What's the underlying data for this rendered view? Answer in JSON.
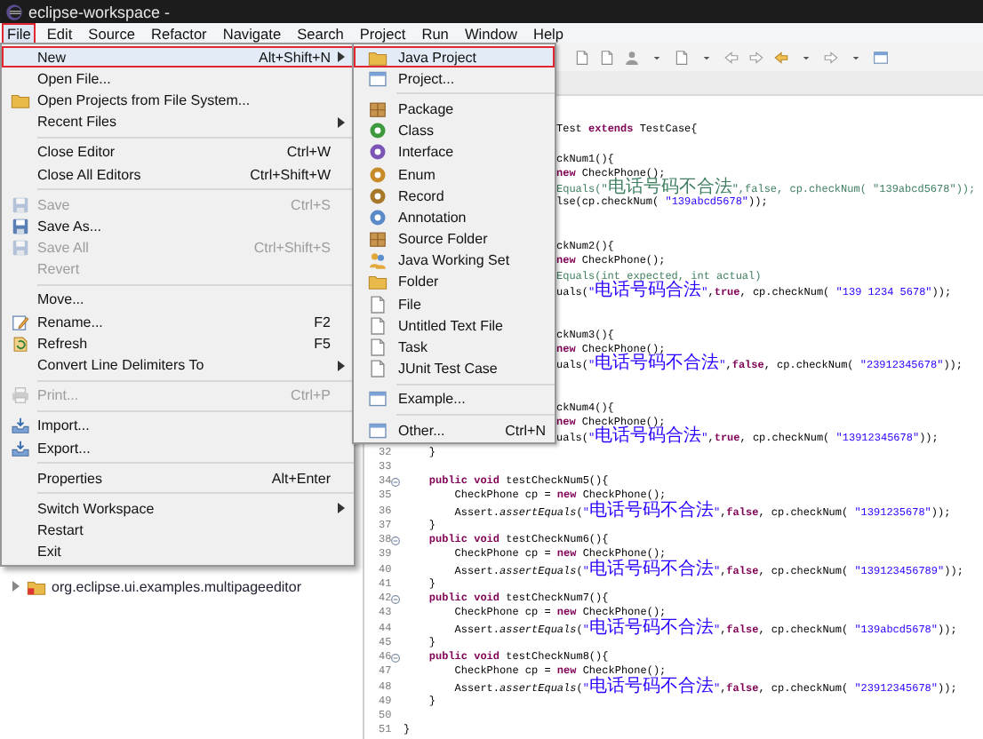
{
  "window": {
    "title": "eclipse-workspace -"
  },
  "menubar": [
    {
      "label": "File",
      "selected": true
    },
    {
      "label": "Edit",
      "selected": false
    },
    {
      "label": "Source",
      "selected": false
    },
    {
      "label": "Refactor",
      "selected": false
    },
    {
      "label": "Navigate",
      "selected": false
    },
    {
      "label": "Search",
      "selected": false
    },
    {
      "label": "Project",
      "selected": false
    },
    {
      "label": "Run",
      "selected": false
    },
    {
      "label": "Window",
      "selected": false
    },
    {
      "label": "Help",
      "selected": false
    }
  ],
  "file_menu": {
    "items": [
      {
        "kind": "item",
        "label": "New",
        "shortcut": "Alt+Shift+N",
        "submenu": true,
        "disabled": false,
        "selected": true
      },
      {
        "kind": "item",
        "label": "Open File...",
        "submenu": false,
        "disabled": false,
        "selected": false
      },
      {
        "kind": "item",
        "label": "Open Projects from File System...",
        "submenu": false,
        "disabled": false,
        "selected": false
      },
      {
        "kind": "item",
        "label": "Recent Files",
        "submenu": true,
        "disabled": false,
        "selected": false
      },
      {
        "kind": "separator"
      },
      {
        "kind": "item",
        "label": "Close Editor",
        "shortcut": "Ctrl+W",
        "submenu": false,
        "disabled": false,
        "selected": false
      },
      {
        "kind": "item",
        "label": "Close All Editors",
        "shortcut": "Ctrl+Shift+W",
        "submenu": false,
        "disabled": false,
        "selected": false
      },
      {
        "kind": "separator"
      },
      {
        "kind": "item",
        "label": "Save",
        "shortcut": "Ctrl+S",
        "submenu": false,
        "disabled": true,
        "selected": false
      },
      {
        "kind": "item",
        "label": "Save As...",
        "submenu": false,
        "disabled": false,
        "selected": false
      },
      {
        "kind": "item",
        "label": "Save All",
        "shortcut": "Ctrl+Shift+S",
        "submenu": false,
        "disabled": true,
        "selected": false
      },
      {
        "kind": "item",
        "label": "Revert",
        "submenu": false,
        "disabled": true,
        "selected": false
      },
      {
        "kind": "separator"
      },
      {
        "kind": "item",
        "label": "Move...",
        "submenu": false,
        "disabled": false,
        "selected": false
      },
      {
        "kind": "item",
        "label": "Rename...",
        "shortcut": "F2",
        "submenu": false,
        "disabled": false,
        "selected": false
      },
      {
        "kind": "item",
        "label": "Refresh",
        "shortcut": "F5",
        "submenu": false,
        "disabled": false,
        "selected": false
      },
      {
        "kind": "item",
        "label": "Convert Line Delimiters To",
        "submenu": true,
        "disabled": false,
        "selected": false
      },
      {
        "kind": "separator"
      },
      {
        "kind": "item",
        "label": "Print...",
        "shortcut": "Ctrl+P",
        "submenu": false,
        "disabled": true,
        "selected": false
      },
      {
        "kind": "separator"
      },
      {
        "kind": "item",
        "label": "Import...",
        "submenu": false,
        "disabled": false,
        "selected": false
      },
      {
        "kind": "item",
        "label": "Export...",
        "submenu": false,
        "disabled": false,
        "selected": false
      },
      {
        "kind": "separator"
      },
      {
        "kind": "item",
        "label": "Properties",
        "shortcut": "Alt+Enter",
        "submenu": false,
        "disabled": false,
        "selected": false
      },
      {
        "kind": "separator"
      },
      {
        "kind": "item",
        "label": "Switch Workspace",
        "submenu": true,
        "disabled": false,
        "selected": false
      },
      {
        "kind": "item",
        "label": "Restart",
        "submenu": false,
        "disabled": false,
        "selected": false
      },
      {
        "kind": "item",
        "label": "Exit",
        "submenu": false,
        "disabled": false,
        "selected": false
      }
    ]
  },
  "new_submenu": {
    "items": [
      {
        "kind": "item",
        "label": "Java Project",
        "disabled": false,
        "selected": true
      },
      {
        "kind": "item",
        "label": "Project...",
        "disabled": false,
        "selected": false
      },
      {
        "kind": "separator"
      },
      {
        "kind": "item",
        "label": "Package",
        "disabled": false,
        "selected": false
      },
      {
        "kind": "item",
        "label": "Class",
        "color": "#3c9a3c",
        "disabled": false,
        "selected": false
      },
      {
        "kind": "item",
        "label": "Interface",
        "color": "#7b55b6",
        "disabled": false,
        "selected": false
      },
      {
        "kind": "item",
        "label": "Enum",
        "color": "#c78b2a",
        "disabled": false,
        "selected": false
      },
      {
        "kind": "item",
        "label": "Record",
        "color": "#a8782a",
        "disabled": false,
        "selected": false
      },
      {
        "kind": "item",
        "label": "Annotation",
        "color": "#5a8ac8",
        "disabled": false,
        "selected": false
      },
      {
        "kind": "item",
        "label": "Source Folder",
        "disabled": false,
        "selected": false
      },
      {
        "kind": "item",
        "label": "Java Working Set",
        "disabled": false,
        "selected": false
      },
      {
        "kind": "item",
        "label": "Folder",
        "disabled": false,
        "selected": false
      },
      {
        "kind": "item",
        "label": "File",
        "disabled": false,
        "selected": false
      },
      {
        "kind": "item",
        "label": "Untitled Text File",
        "disabled": false,
        "selected": false
      },
      {
        "kind": "item",
        "label": "Task",
        "disabled": false,
        "selected": false
      },
      {
        "kind": "item",
        "label": "JUnit Test Case",
        "disabled": false,
        "selected": false
      },
      {
        "kind": "separator"
      },
      {
        "kind": "item",
        "label": "Example...",
        "disabled": false,
        "selected": false
      },
      {
        "kind": "separator"
      },
      {
        "kind": "item",
        "label": "Other...",
        "shortcut": "Ctrl+N",
        "disabled": false,
        "selected": false
      }
    ]
  },
  "package_explorer": {
    "items": [
      {
        "label": "org.eclipse.ui.examples.multipageeditor",
        "expanded": false
      }
    ]
  },
  "editor": {
    "lines": [
      {
        "kind": "code",
        "fold": false,
        "segments": [
          {
            "kind": "plain",
            "text": "Test "
          },
          {
            "kind": "keyword",
            "text": "extends"
          },
          {
            "kind": "plain",
            "text": " TestCase{"
          }
        ]
      },
      {
        "kind": "blank"
      },
      {
        "kind": "code",
        "fold": false,
        "segments": [
          {
            "kind": "plain",
            "text": "ckNum1(){"
          }
        ]
      },
      {
        "kind": "code",
        "fold": false,
        "segments": [
          {
            "kind": "keyword",
            "text": "new"
          },
          {
            "kind": "plain",
            "text": " CheckPhone();"
          }
        ]
      },
      {
        "kind": "code",
        "fold": false,
        "segments": [
          {
            "kind": "comment",
            "text": "Equals(\"电话号码不合法\",false, cp.checkNum( \"139abcd5678\"));"
          }
        ]
      },
      {
        "kind": "code",
        "fold": false,
        "segments": [
          {
            "kind": "plain",
            "text": "lse(cp.checkNum( "
          },
          {
            "kind": "string",
            "text": "\"139abcd5678\""
          },
          {
            "kind": "plain",
            "text": "));"
          }
        ]
      },
      {
        "kind": "blank"
      },
      {
        "kind": "blank"
      },
      {
        "kind": "code",
        "fold": false,
        "segments": [
          {
            "kind": "plain",
            "text": "ckNum2(){"
          }
        ]
      },
      {
        "kind": "code",
        "fold": false,
        "segments": [
          {
            "kind": "keyword",
            "text": "new"
          },
          {
            "kind": "plain",
            "text": " CheckPhone();"
          }
        ]
      },
      {
        "kind": "code",
        "fold": false,
        "segments": [
          {
            "kind": "comment",
            "text": "Equals(int expected, int actual)"
          }
        ]
      },
      {
        "kind": "code",
        "fold": false,
        "segments": [
          {
            "kind": "plain",
            "text": "uals("
          },
          {
            "kind": "string",
            "text": "\"电话号码合法\""
          },
          {
            "kind": "plain",
            "text": ","
          },
          {
            "kind": "keyword",
            "text": "true"
          },
          {
            "kind": "plain",
            "text": ", cp.checkNum( "
          },
          {
            "kind": "string",
            "text": "\"139 1234 5678\""
          },
          {
            "kind": "plain",
            "text": "));"
          }
        ]
      },
      {
        "kind": "blank"
      },
      {
        "kind": "blank"
      },
      {
        "kind": "code",
        "fold": false,
        "segments": [
          {
            "kind": "plain",
            "text": "ckNum3(){"
          }
        ]
      },
      {
        "kind": "code",
        "fold": false,
        "segments": [
          {
            "kind": "keyword",
            "text": "new"
          },
          {
            "kind": "plain",
            "text": " CheckPhone();"
          }
        ]
      },
      {
        "kind": "code",
        "fold": false,
        "segments": [
          {
            "kind": "plain",
            "text": "uals("
          },
          {
            "kind": "string",
            "text": "\"电话号码不合法\""
          },
          {
            "kind": "plain",
            "text": ","
          },
          {
            "kind": "keyword",
            "text": "false"
          },
          {
            "kind": "plain",
            "text": ", cp.checkNum( "
          },
          {
            "kind": "string",
            "text": "\"23912345678\""
          },
          {
            "kind": "plain",
            "text": "));"
          }
        ]
      },
      {
        "kind": "blank"
      },
      {
        "kind": "blank"
      },
      {
        "kind": "code",
        "fold": false,
        "segments": [
          {
            "kind": "plain",
            "text": "ckNum4(){"
          }
        ]
      },
      {
        "kind": "code",
        "fold": false,
        "segments": [
          {
            "kind": "keyword",
            "text": "new"
          },
          {
            "kind": "plain",
            "text": " CheckPhone();"
          }
        ]
      },
      {
        "kind": "code",
        "fold": false,
        "segments": [
          {
            "kind": "plain",
            "text": "uals("
          },
          {
            "kind": "string",
            "text": "\"电话号码合法\""
          },
          {
            "kind": "plain",
            "text": ","
          },
          {
            "kind": "keyword",
            "text": "true"
          },
          {
            "kind": "plain",
            "text": ", cp.checkNum( "
          },
          {
            "kind": "string",
            "text": "\"13912345678\""
          },
          {
            "kind": "plain",
            "text": "));"
          }
        ]
      },
      {
        "kind": "code",
        "number": "32",
        "fold": false,
        "segments": [
          {
            "kind": "plain",
            "text": "    }"
          }
        ]
      },
      {
        "kind": "code",
        "number": "33",
        "fold": false
      },
      {
        "kind": "code",
        "number": "34",
        "fold": true,
        "segments": [
          {
            "kind": "keyword",
            "text": "    public void"
          },
          {
            "kind": "plain",
            "text": " testCheckNum5(){"
          }
        ]
      },
      {
        "kind": "code",
        "number": "35",
        "fold": false,
        "segments": [
          {
            "kind": "plain",
            "text": "        CheckPhone cp = "
          },
          {
            "kind": "keyword",
            "text": "new"
          },
          {
            "kind": "plain",
            "text": " CheckPhone();"
          }
        ]
      },
      {
        "kind": "code",
        "number": "36",
        "fold": false,
        "segments": [
          {
            "kind": "plain",
            "text": "        Assert."
          },
          {
            "kind": "static",
            "text": "assertEquals"
          },
          {
            "kind": "plain",
            "text": "("
          },
          {
            "kind": "string",
            "text": "\"电话号码不合法\""
          },
          {
            "kind": "plain",
            "text": ","
          },
          {
            "kind": "keyword",
            "text": "false"
          },
          {
            "kind": "plain",
            "text": ", cp.checkNum( "
          },
          {
            "kind": "string",
            "text": "\"1391235678\""
          },
          {
            "kind": "plain",
            "text": "));"
          }
        ]
      },
      {
        "kind": "code",
        "number": "37",
        "fold": false,
        "segments": [
          {
            "kind": "plain",
            "text": "    }"
          }
        ]
      },
      {
        "kind": "code",
        "number": "38",
        "fold": true,
        "segments": [
          {
            "kind": "keyword",
            "text": "    public void"
          },
          {
            "kind": "plain",
            "text": " testCheckNum6(){"
          }
        ]
      },
      {
        "kind": "code",
        "number": "39",
        "fold": false,
        "segments": [
          {
            "kind": "plain",
            "text": "        CheckPhone cp = "
          },
          {
            "kind": "keyword",
            "text": "new"
          },
          {
            "kind": "plain",
            "text": " CheckPhone();"
          }
        ]
      },
      {
        "kind": "code",
        "number": "40",
        "fold": false,
        "segments": [
          {
            "kind": "plain",
            "text": "        Assert."
          },
          {
            "kind": "static",
            "text": "assertEquals"
          },
          {
            "kind": "plain",
            "text": "("
          },
          {
            "kind": "string",
            "text": "\"电话号码不合法\""
          },
          {
            "kind": "plain",
            "text": ","
          },
          {
            "kind": "keyword",
            "text": "false"
          },
          {
            "kind": "plain",
            "text": ", cp.checkNum( "
          },
          {
            "kind": "string",
            "text": "\"139123456789\""
          },
          {
            "kind": "plain",
            "text": "));"
          }
        ]
      },
      {
        "kind": "code",
        "number": "41",
        "fold": false,
        "segments": [
          {
            "kind": "plain",
            "text": "    }"
          }
        ]
      },
      {
        "kind": "code",
        "number": "42",
        "fold": true,
        "segments": [
          {
            "kind": "keyword",
            "text": "    public void"
          },
          {
            "kind": "plain",
            "text": " testCheckNum7(){"
          }
        ]
      },
      {
        "kind": "code",
        "number": "43",
        "fold": false,
        "segments": [
          {
            "kind": "plain",
            "text": "        CheckPhone cp = "
          },
          {
            "kind": "keyword",
            "text": "new"
          },
          {
            "kind": "plain",
            "text": " CheckPhone();"
          }
        ]
      },
      {
        "kind": "code",
        "number": "44",
        "fold": false,
        "segments": [
          {
            "kind": "plain",
            "text": "        Assert."
          },
          {
            "kind": "static",
            "text": "assertEquals"
          },
          {
            "kind": "plain",
            "text": "("
          },
          {
            "kind": "string",
            "text": "\"电话号码不合法\""
          },
          {
            "kind": "plain",
            "text": ","
          },
          {
            "kind": "keyword",
            "text": "false"
          },
          {
            "kind": "plain",
            "text": ", cp.checkNum( "
          },
          {
            "kind": "string",
            "text": "\"139abcd5678\""
          },
          {
            "kind": "plain",
            "text": "));"
          }
        ]
      },
      {
        "kind": "code",
        "number": "45",
        "fold": false,
        "segments": [
          {
            "kind": "plain",
            "text": "    }"
          }
        ]
      },
      {
        "kind": "code",
        "number": "46",
        "fold": true,
        "segments": [
          {
            "kind": "keyword",
            "text": "    public void"
          },
          {
            "kind": "plain",
            "text": " testCheckNum8(){"
          }
        ]
      },
      {
        "kind": "code",
        "number": "47",
        "fold": false,
        "segments": [
          {
            "kind": "plain",
            "text": "        CheckPhone cp = "
          },
          {
            "kind": "keyword",
            "text": "new"
          },
          {
            "kind": "plain",
            "text": " CheckPhone();"
          }
        ]
      },
      {
        "kind": "code",
        "number": "48",
        "fold": false,
        "segments": [
          {
            "kind": "plain",
            "text": "        Assert."
          },
          {
            "kind": "static",
            "text": "assertEquals"
          },
          {
            "kind": "plain",
            "text": "("
          },
          {
            "kind": "string",
            "text": "\"电话号码不合法\""
          },
          {
            "kind": "plain",
            "text": ","
          },
          {
            "kind": "keyword",
            "text": "false"
          },
          {
            "kind": "plain",
            "text": ", cp.checkNum( "
          },
          {
            "kind": "string",
            "text": "\"23912345678\""
          },
          {
            "kind": "plain",
            "text": "));"
          }
        ]
      },
      {
        "kind": "code",
        "number": "49",
        "fold": false,
        "segments": [
          {
            "kind": "plain",
            "text": "    }"
          }
        ]
      },
      {
        "kind": "code",
        "number": "50",
        "fold": false
      },
      {
        "kind": "code",
        "number": "51",
        "fold": false,
        "segments": [
          {
            "kind": "plain",
            "text": "}"
          }
        ]
      }
    ]
  }
}
